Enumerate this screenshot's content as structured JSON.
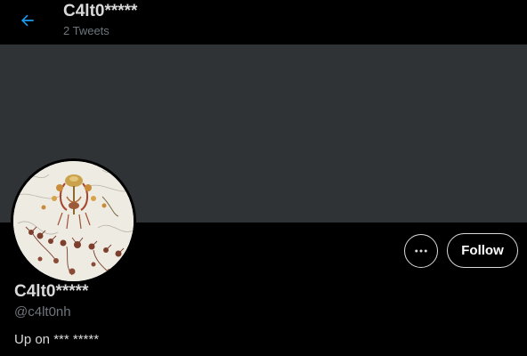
{
  "header": {
    "title": "C4lt0*****",
    "tweet_count": "2 Tweets",
    "back_icon": "arrow-left-icon"
  },
  "profile": {
    "display_name": "C4lt0*****",
    "handle": "@c4lt0nh",
    "bio": "Up on *** *****"
  },
  "actions": {
    "more_icon": "more-horizontal-icon",
    "follow_label": "Follow"
  },
  "colors": {
    "background": "#000000",
    "banner": "#2f3336",
    "accent": "#1d9bf0",
    "primary_text": "#d9d9d9",
    "secondary_text": "#6e767d"
  }
}
